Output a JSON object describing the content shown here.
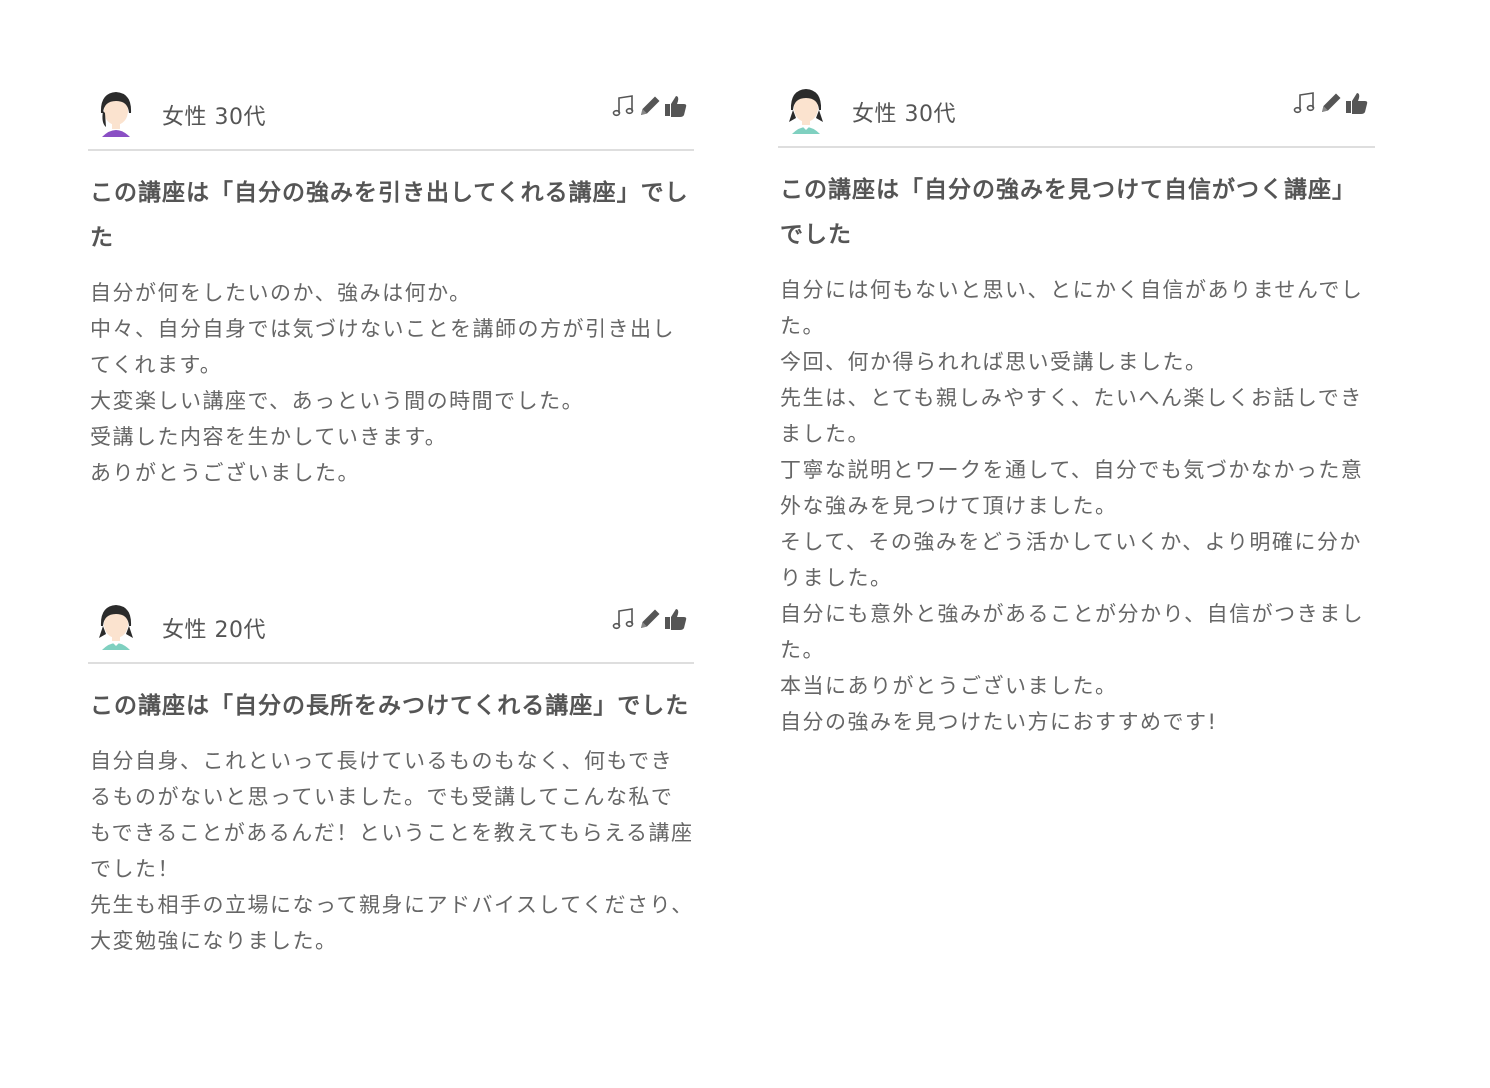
{
  "reviews": [
    {
      "reviewer": "女性 30代",
      "avatar": "avatar-purple-icon",
      "title": "この講座は「自分の強みを引き出してくれる講座」でした",
      "body": [
        "自分が何をしたいのか、強みは何か。",
        "中々、自分自身では気づけないことを講師の方が引き出してくれます。",
        "大変楽しい講座で、あっという間の時間でした。",
        "受講した内容を生かしていきます。",
        "ありがとうございました。"
      ]
    },
    {
      "reviewer": "女性 20代",
      "avatar": "avatar-teal-icon",
      "title": "この講座は「自分の長所をみつけてくれる講座」でした",
      "body": [
        "自分自身、これといって長けているものもなく、何もできるものがないと思っていました。でも受講してこんな私でもできることがあるんだ！ということを教えてもらえる講座でした！",
        "先生も相手の立場になって親身にアドバイスしてくださり、大変勉強になりました。"
      ]
    },
    {
      "reviewer": "女性 30代",
      "avatar": "avatar-teal-icon",
      "title": "この講座は「自分の強みを見つけて自信がつく講座」でした",
      "body": [
        "自分には何もないと思い、とにかく自信がありませんでした。",
        "今回、何か得られれば思い受講しました。",
        "先生は、とても親しみやすく、たいへん楽しくお話しできました。",
        "丁寧な説明とワークを通して、自分でも気づかなかった意外な強みを見つけて頂けました。",
        "そして、その強みをどう活かしていくか、より明確に分かりました。",
        "自分にも意外と強みがあることが分かり、自信がつきました。",
        "本当にありがとうございました。",
        "自分の強みを見つけたい方におすすめです!"
      ]
    }
  ],
  "icons": [
    "music-note-icon",
    "pencil-icon",
    "thumbs-up-icon"
  ],
  "colors": {
    "text": "#555555",
    "body_text": "#666666",
    "divider": "#dedede",
    "icon": "#555555",
    "avatar_hair": "#2b2b2b",
    "avatar_skin": "#fbe3cf",
    "avatar_purple": "#8a4fc4",
    "avatar_teal": "#7fd0c0"
  }
}
